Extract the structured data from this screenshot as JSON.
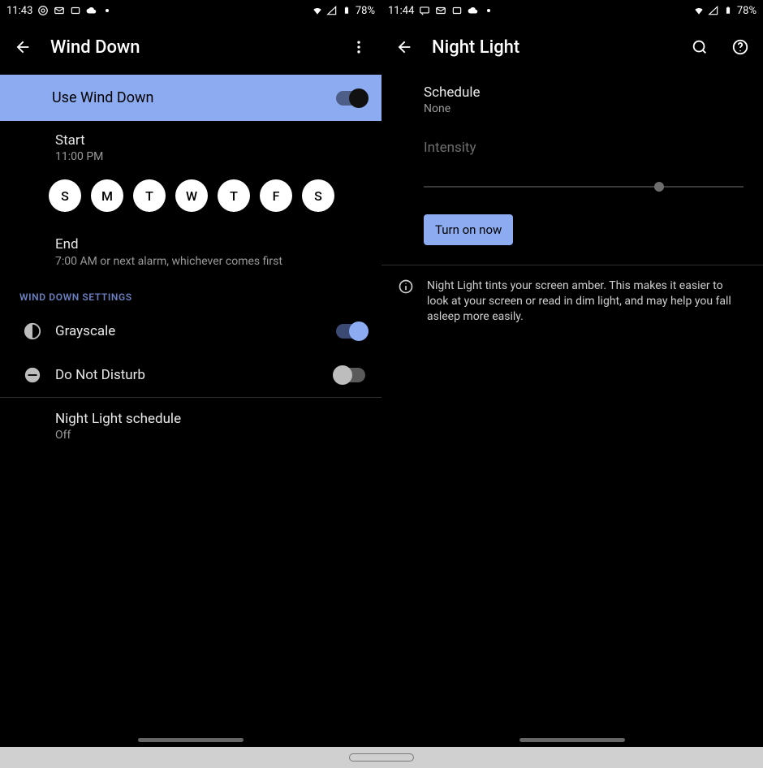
{
  "left": {
    "status": {
      "time": "11:43",
      "battery": "78%"
    },
    "appbar": {
      "title": "Wind Down"
    },
    "use": {
      "label": "Use Wind Down",
      "on": true
    },
    "start": {
      "label": "Start",
      "value": "11:00 PM"
    },
    "days": [
      "S",
      "M",
      "T",
      "W",
      "T",
      "F",
      "S"
    ],
    "end": {
      "label": "End",
      "value": "7:00 AM or next alarm, whichever comes first"
    },
    "section": "WIND DOWN SETTINGS",
    "grayscale": {
      "label": "Grayscale",
      "on": true
    },
    "dnd": {
      "label": "Do Not Disturb",
      "on": false
    },
    "night": {
      "label": "Night Light schedule",
      "value": "Off"
    }
  },
  "right": {
    "status": {
      "time": "11:44",
      "battery": "78%"
    },
    "appbar": {
      "title": "Night Light"
    },
    "schedule": {
      "label": "Schedule",
      "value": "None"
    },
    "intensity": {
      "label": "Intensity",
      "position": 72
    },
    "button": "Turn on now",
    "info": "Night Light tints your screen amber. This makes it easier to look at your screen or read in dim light, and may help you fall asleep more easily."
  }
}
